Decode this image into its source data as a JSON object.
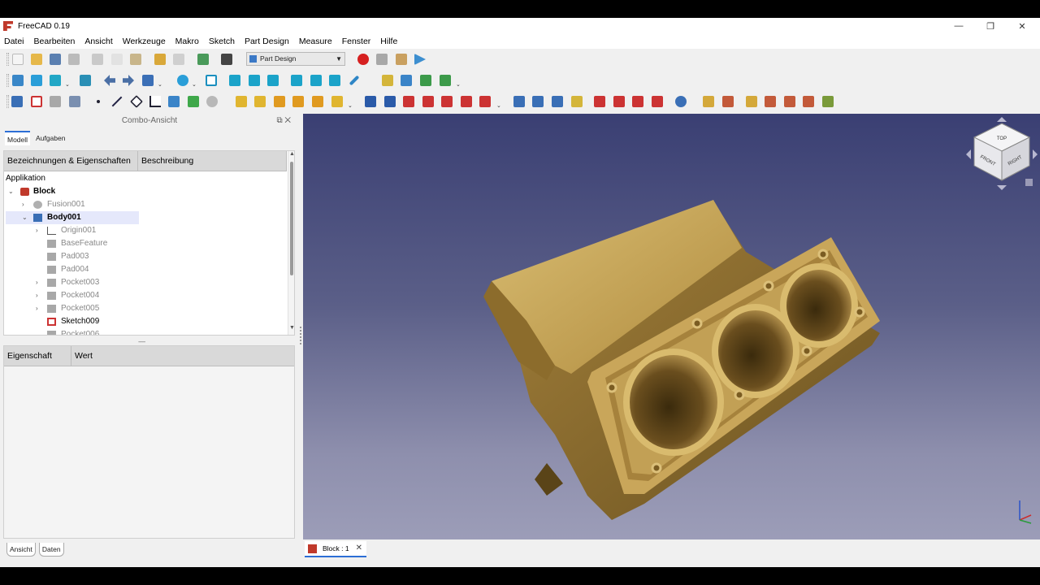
{
  "window": {
    "title": "FreeCAD 0.19",
    "minimize": "—",
    "restore": "❐",
    "close": "✕"
  },
  "menu": [
    "Datei",
    "Bearbeiten",
    "Ansicht",
    "Werkzeuge",
    "Makro",
    "Sketch",
    "Part Design",
    "Measure",
    "Fenster",
    "Hilfe"
  ],
  "workbench": {
    "selected": "Part Design"
  },
  "combo_view": {
    "title": "Combo-Ansicht",
    "tabs": [
      "Modell",
      "Aufgaben"
    ],
    "tree_headers": [
      "Bezeichnungen & Eigenschaften",
      "Beschreibung"
    ],
    "root_label": "Applikation",
    "tree": [
      {
        "label": "Block",
        "style": "bold"
      },
      {
        "label": "Fusion001",
        "style": "grey"
      },
      {
        "label": "Body001",
        "style": "bold"
      },
      {
        "label": "Origin001",
        "style": "grey"
      },
      {
        "label": "BaseFeature",
        "style": "grey"
      },
      {
        "label": "Pad003",
        "style": "grey"
      },
      {
        "label": "Pad004",
        "style": "grey"
      },
      {
        "label": "Pocket003",
        "style": "grey"
      },
      {
        "label": "Pocket004",
        "style": "grey"
      },
      {
        "label": "Pocket005",
        "style": "grey"
      },
      {
        "label": "Sketch009",
        "style": "normal"
      },
      {
        "label": "Pocket006",
        "style": "grey"
      }
    ],
    "prop_headers": [
      "Eigenschaft",
      "Wert"
    ],
    "bottom_tabs": [
      "Ansicht",
      "Daten"
    ]
  },
  "document_tab": {
    "label": "Block : 1",
    "close": "✕"
  },
  "navcube": {
    "faces": [
      "TOP",
      "FRONT",
      "RIGHT"
    ]
  },
  "colors": {
    "accent": "#2c6ed5",
    "part": "#b8954a",
    "view_top": "#3a3f73",
    "view_bottom": "#9c9db8"
  }
}
